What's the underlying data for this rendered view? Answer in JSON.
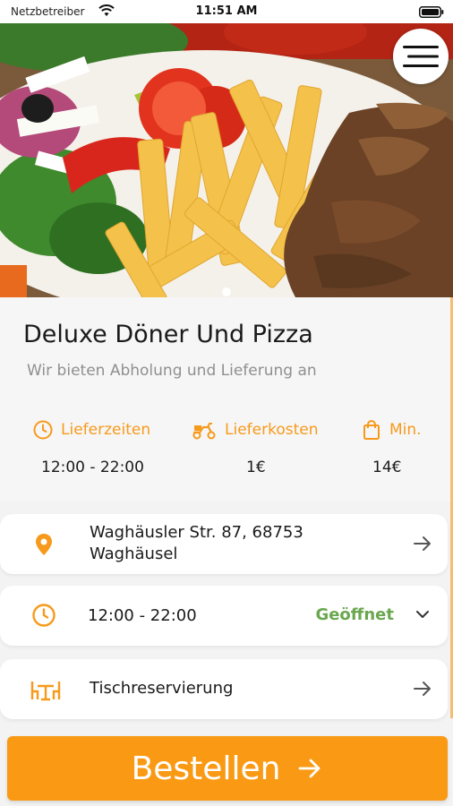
{
  "status_bar": {
    "carrier": "Netzbetreiber",
    "time": "11:51 AM"
  },
  "hero": {
    "image": "doner-plate-with-fries-and-salad",
    "page_indicator": {
      "pages": 1,
      "current": 1
    }
  },
  "restaurant": {
    "name": "Deluxe Döner Und Pizza",
    "tagline": "Wir bieten Abholung und Lieferung an"
  },
  "info": [
    {
      "icon": "clock-icon",
      "label": "Lieferzeiten",
      "value": "12:00 - 22:00"
    },
    {
      "icon": "delivery-scooter-icon",
      "label": "Lieferkosten",
      "value": "1€"
    },
    {
      "icon": "shopping-bag-icon",
      "label": "Min.",
      "value": "14€"
    }
  ],
  "rows": {
    "address": {
      "icon": "location-pin-icon",
      "line1": "Waghäusler Str. 87, 68753",
      "line2": "Waghäusel"
    },
    "hours": {
      "icon": "clock-icon",
      "value": "12:00 - 22:00",
      "status": "Geöffnet"
    },
    "reservation": {
      "icon": "table-icon",
      "label": "Tischreservierung"
    }
  },
  "order_button": {
    "label": "Bestellen"
  },
  "colors": {
    "accent": "#f79a1b",
    "open": "#6aa74f",
    "button": "#fa9a14"
  }
}
